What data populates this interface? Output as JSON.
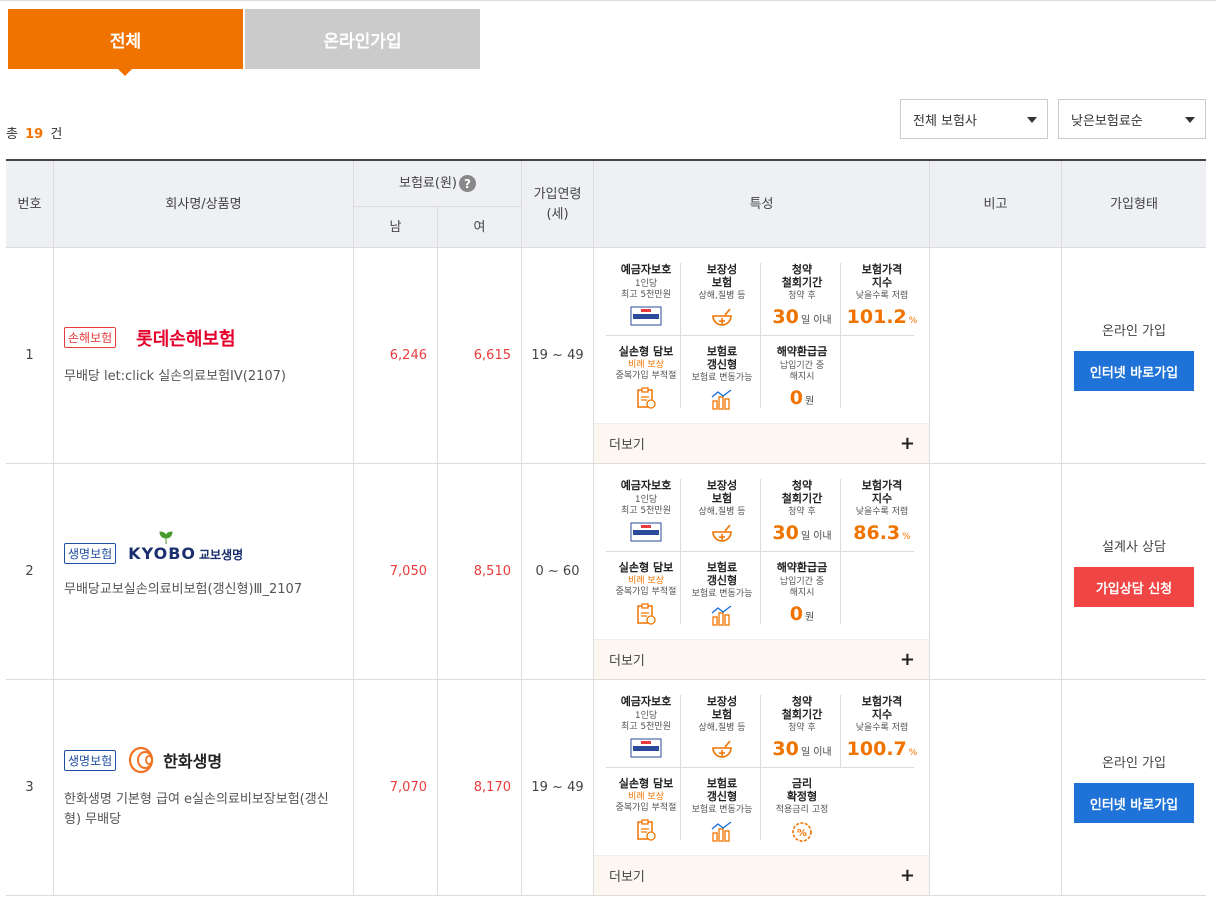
{
  "tabs": [
    {
      "label": "전체",
      "active": true
    },
    {
      "label": "온라인가입",
      "active": false
    }
  ],
  "summary": {
    "prefix": "총",
    "count": "19",
    "suffix": "건"
  },
  "filters": {
    "company": "전체 보험사",
    "sort": "낮은보험료순"
  },
  "table_header": {
    "no": "번호",
    "name": "회사명/상품명",
    "premium": "보험료(원)",
    "premium_help": "?",
    "male": "남",
    "female": "여",
    "age": "가입연령\n(세)",
    "features": "특성",
    "note": "비고",
    "join": "가입형태"
  },
  "features_common": {
    "deposit_title": "예금자보호",
    "deposit_sub1": "1인당",
    "deposit_sub2": "최고 5천만원",
    "coverage_title": "보장성\n보험",
    "coverage_sub": "상해,질병 등",
    "withdraw_title": "청약\n철회기간",
    "withdraw_sub": "청약 후",
    "withdraw_value": "30",
    "withdraw_unit": "일 이내",
    "index_title": "보험가격\n지수",
    "index_sub": "낮을수록 저렴",
    "index_unit": "%",
    "indemnity_title": "실손형 담보",
    "indemnity_sub1": "비례 보상",
    "indemnity_sub2": "중복가입 부적절",
    "renew_title": "보험료\n갱신형",
    "renew_sub": "보험료 변동가능",
    "refund_title": "해약환급금",
    "refund_sub1": "납입기간 중",
    "refund_sub2": "해지시",
    "refund_value": "0",
    "refund_unit": "원",
    "rate_title": "금리\n확정형",
    "rate_sub": "적용금리 고정",
    "more": "더보기",
    "more_icon": "+"
  },
  "rows": [
    {
      "no": "1",
      "type": "손해보험",
      "company": "롯데손해보험",
      "product": "무배당 let:click 실손의료보험IV(2107)",
      "male": "6,246",
      "female": "6,615",
      "age": "19 ~ 49",
      "index": "101.2",
      "join_label": "온라인 가입",
      "button": "인터넷 바로가입",
      "button_color": "#1e72d8"
    },
    {
      "no": "2",
      "type": "생명보험",
      "company_en": "KYOBO",
      "company": "교보생명",
      "product": "무배당교보실손의료비보험(갱신형)Ⅲ_2107",
      "male": "7,050",
      "female": "8,510",
      "age": "0 ~ 60",
      "index": "86.3",
      "join_label": "설계사 상담",
      "button": "가입상담 신청",
      "button_color": "#ef4545"
    },
    {
      "no": "3",
      "type": "생명보험",
      "company": "한화생명",
      "product": "한화생명 기본형 급여 e실손의료비보장보험(갱신형) 무배당",
      "male": "7,070",
      "female": "8,170",
      "age": "19 ~ 49",
      "index": "100.7",
      "join_label": "온라인 가입",
      "button": "인터넷 바로가입",
      "button_color": "#1e72d8"
    }
  ],
  "colors": {
    "accent": "#f07300",
    "tab_inactive": "#cbcbcb",
    "price": "#e83c3c",
    "btn_blue": "#1e72d8",
    "btn_red": "#ef4545",
    "lotte": "#e4002b",
    "kyobo_navy": "#1b2f6e",
    "kyobo_green": "#4a9a2e",
    "hanwha": "#f37321"
  }
}
